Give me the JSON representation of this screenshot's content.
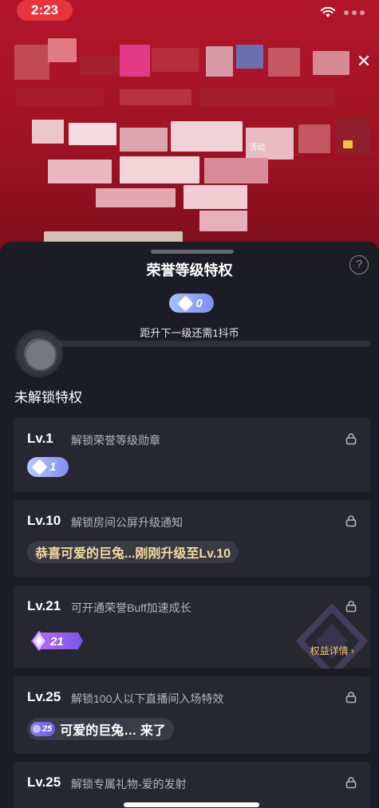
{
  "status_bar": {
    "time": "2:23"
  },
  "promo": {
    "tag": "活动"
  },
  "sheet": {
    "title": "荣誉等级特权",
    "help_symbol": "?",
    "current_level": "0",
    "progress_hint": "距升下一级还需1抖币",
    "progress_fraction": 0,
    "section_title": "未解锁特权"
  },
  "cards": [
    {
      "level": "Lv.1",
      "desc": "解锁荣誉等级勋章",
      "badge_num": "1"
    },
    {
      "level": "Lv.10",
      "desc": "解锁房间公屏升级通知",
      "notice": "恭喜可爱的巨兔...刚刚升级至Lv.10"
    },
    {
      "level": "Lv.21",
      "desc": "可开通荣誉Buff加速成长",
      "badge_num": "21",
      "link": "权益详情 ›"
    },
    {
      "level": "Lv.25",
      "desc": "解锁100人以下直播间入场特效",
      "badge_num": "25",
      "enter_text": "可爱的巨兔… 来了"
    },
    {
      "level": "Lv.25",
      "desc": "解锁专属礼物-爱的发射"
    }
  ],
  "colors": {
    "accent_red": "#b3162b",
    "sheet_bg": "#1c1c24",
    "card_bg": "#272731",
    "gold_text": "#f3dca0",
    "link_gold": "#f0c967"
  }
}
